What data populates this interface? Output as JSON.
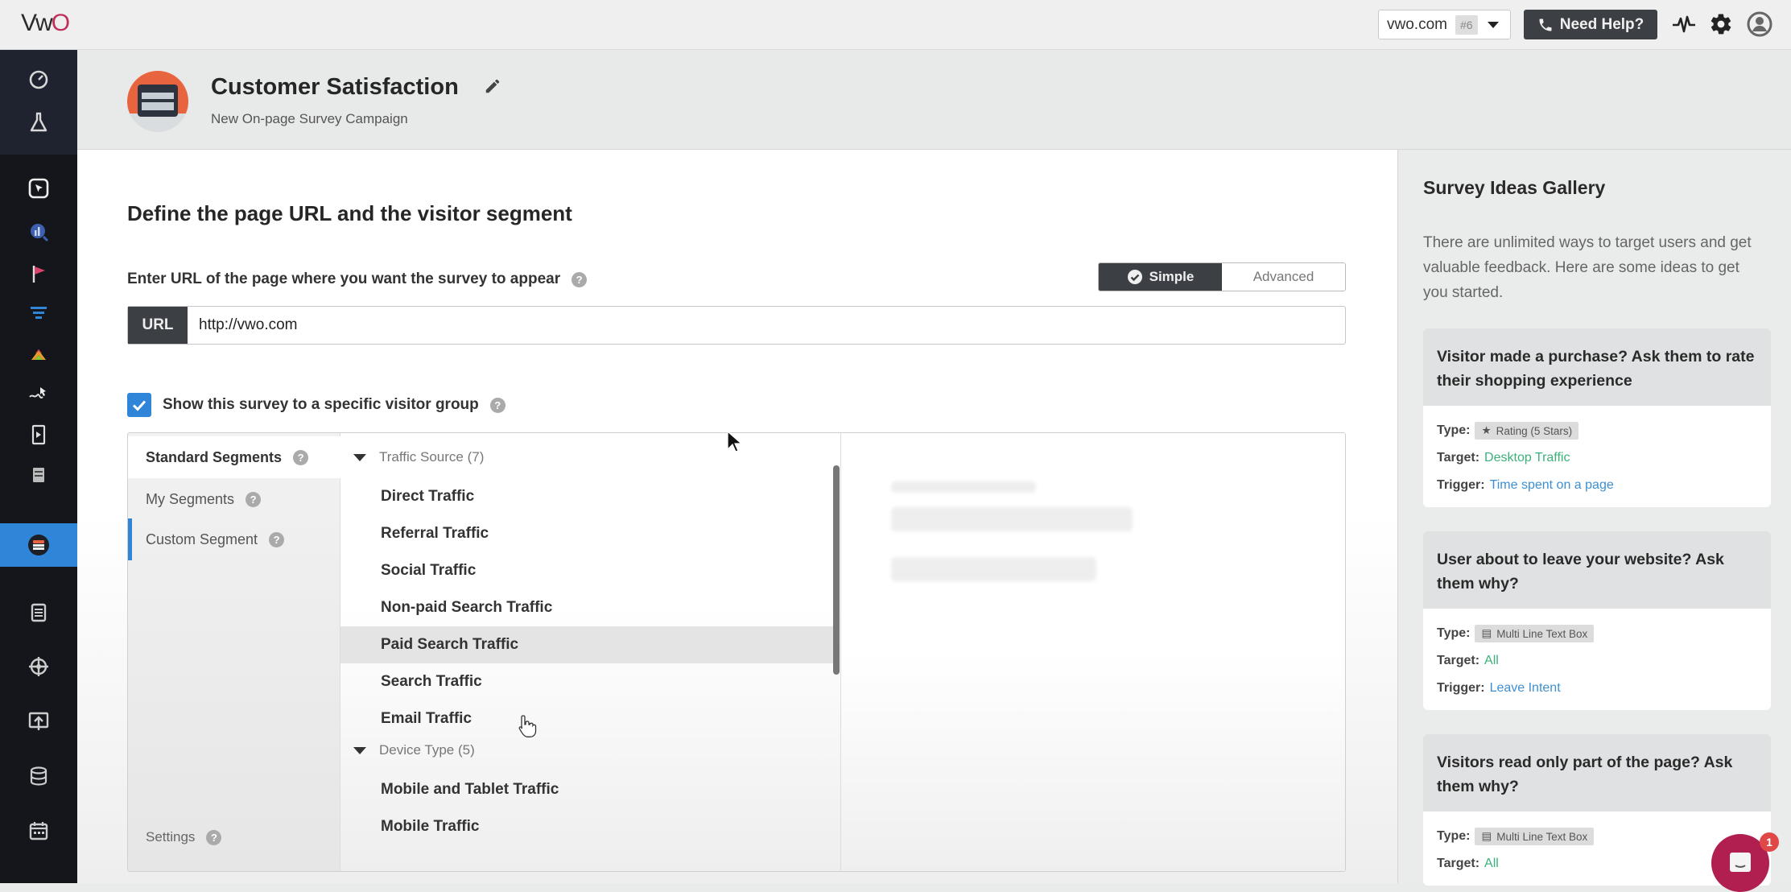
{
  "topbar": {
    "logo": {
      "v": "V",
      "w": "w",
      "o": "O"
    },
    "account": {
      "name": "vwo.com",
      "badge": "#6"
    },
    "help_label": "Need Help?",
    "icons": [
      "activity-icon",
      "gear-icon",
      "user-avatar-icon"
    ]
  },
  "sidebar": {
    "items": [
      {
        "name": "dashboard",
        "icon": "gauge-icon"
      },
      {
        "name": "testing",
        "icon": "flask-icon"
      },
      {
        "name": "insights",
        "icon": "cursor-box-icon"
      },
      {
        "name": "analytics",
        "icon": "chart-search-icon"
      },
      {
        "name": "goals",
        "icon": "flag-icon"
      },
      {
        "name": "funnels",
        "icon": "funnel-icon"
      },
      {
        "name": "heatmaps",
        "icon": "heatmap-icon"
      },
      {
        "name": "recordings",
        "icon": "session-path-icon"
      },
      {
        "name": "form-analytics",
        "icon": "form-play-icon"
      },
      {
        "name": "forms",
        "icon": "form-icon"
      },
      {
        "name": "surveys",
        "icon": "survey-icon",
        "active": true
      },
      {
        "name": "plans",
        "icon": "clipboard-icon"
      },
      {
        "name": "targeting",
        "icon": "crosshair-icon"
      },
      {
        "name": "deploy",
        "icon": "presentation-upload-icon"
      },
      {
        "name": "data",
        "icon": "database-icon"
      },
      {
        "name": "calendar",
        "icon": "calendar-icon"
      }
    ]
  },
  "header": {
    "title": "Customer Satisfaction",
    "subtitle": "New On-page Survey Campaign"
  },
  "main": {
    "section_title": "Define the page URL and the visitor segment",
    "url_label": "Enter URL of the page where you want the survey to appear",
    "mode_toggle": {
      "simple": "Simple",
      "advanced": "Advanced",
      "selected": "Simple"
    },
    "url_addon": "URL",
    "url_value": "http://vwo.com",
    "visitor_group_label": "Show this survey to a specific visitor group",
    "visitor_group_checked": true,
    "segments": {
      "tabs": [
        {
          "label": "Standard Segments",
          "active": true
        },
        {
          "label": "My Segments"
        },
        {
          "label": "Custom Segment"
        }
      ],
      "settings_label": "Settings",
      "groups": [
        {
          "label": "Traffic Source (7)",
          "items": [
            "Direct Traffic",
            "Referral Traffic",
            "Social Traffic",
            "Non-paid Search Traffic",
            "Paid Search Traffic",
            "Search Traffic",
            "Email Traffic"
          ]
        },
        {
          "label": "Device Type (5)",
          "items": [
            "Mobile and Tablet Traffic",
            "Mobile Traffic"
          ]
        }
      ],
      "hovered_item": "Paid Search Traffic"
    }
  },
  "gallery": {
    "title": "Survey Ideas Gallery",
    "description": "There are unlimited ways to target users and get valuable feedback. Here are some ideas to get you started.",
    "type_label": "Type:",
    "target_label": "Target:",
    "trigger_label": "Trigger:",
    "ideas": [
      {
        "title": "Visitor made a purchase? Ask them to rate their shopping experience",
        "type": "Rating (5 Stars)",
        "type_icon": "star-icon",
        "target": "Desktop Traffic",
        "trigger": "Time spent on a page"
      },
      {
        "title": "User about to leave your website? Ask them why?",
        "type": "Multi Line Text Box",
        "type_icon": "textbox-icon",
        "target": "All",
        "trigger": "Leave Intent"
      },
      {
        "title": "Visitors read only part of the page? Ask them why?",
        "type": "Multi Line Text Box",
        "type_icon": "textbox-icon",
        "target": "All",
        "trigger": ""
      }
    ]
  },
  "chat": {
    "badge_count": "1"
  },
  "colors": {
    "accent": "#2f86d8",
    "dark": "#3c3f44",
    "target": "#3bb27a",
    "trigger": "#3d8fd1",
    "brand": "#c0305a",
    "chat": "#b01f4f"
  }
}
